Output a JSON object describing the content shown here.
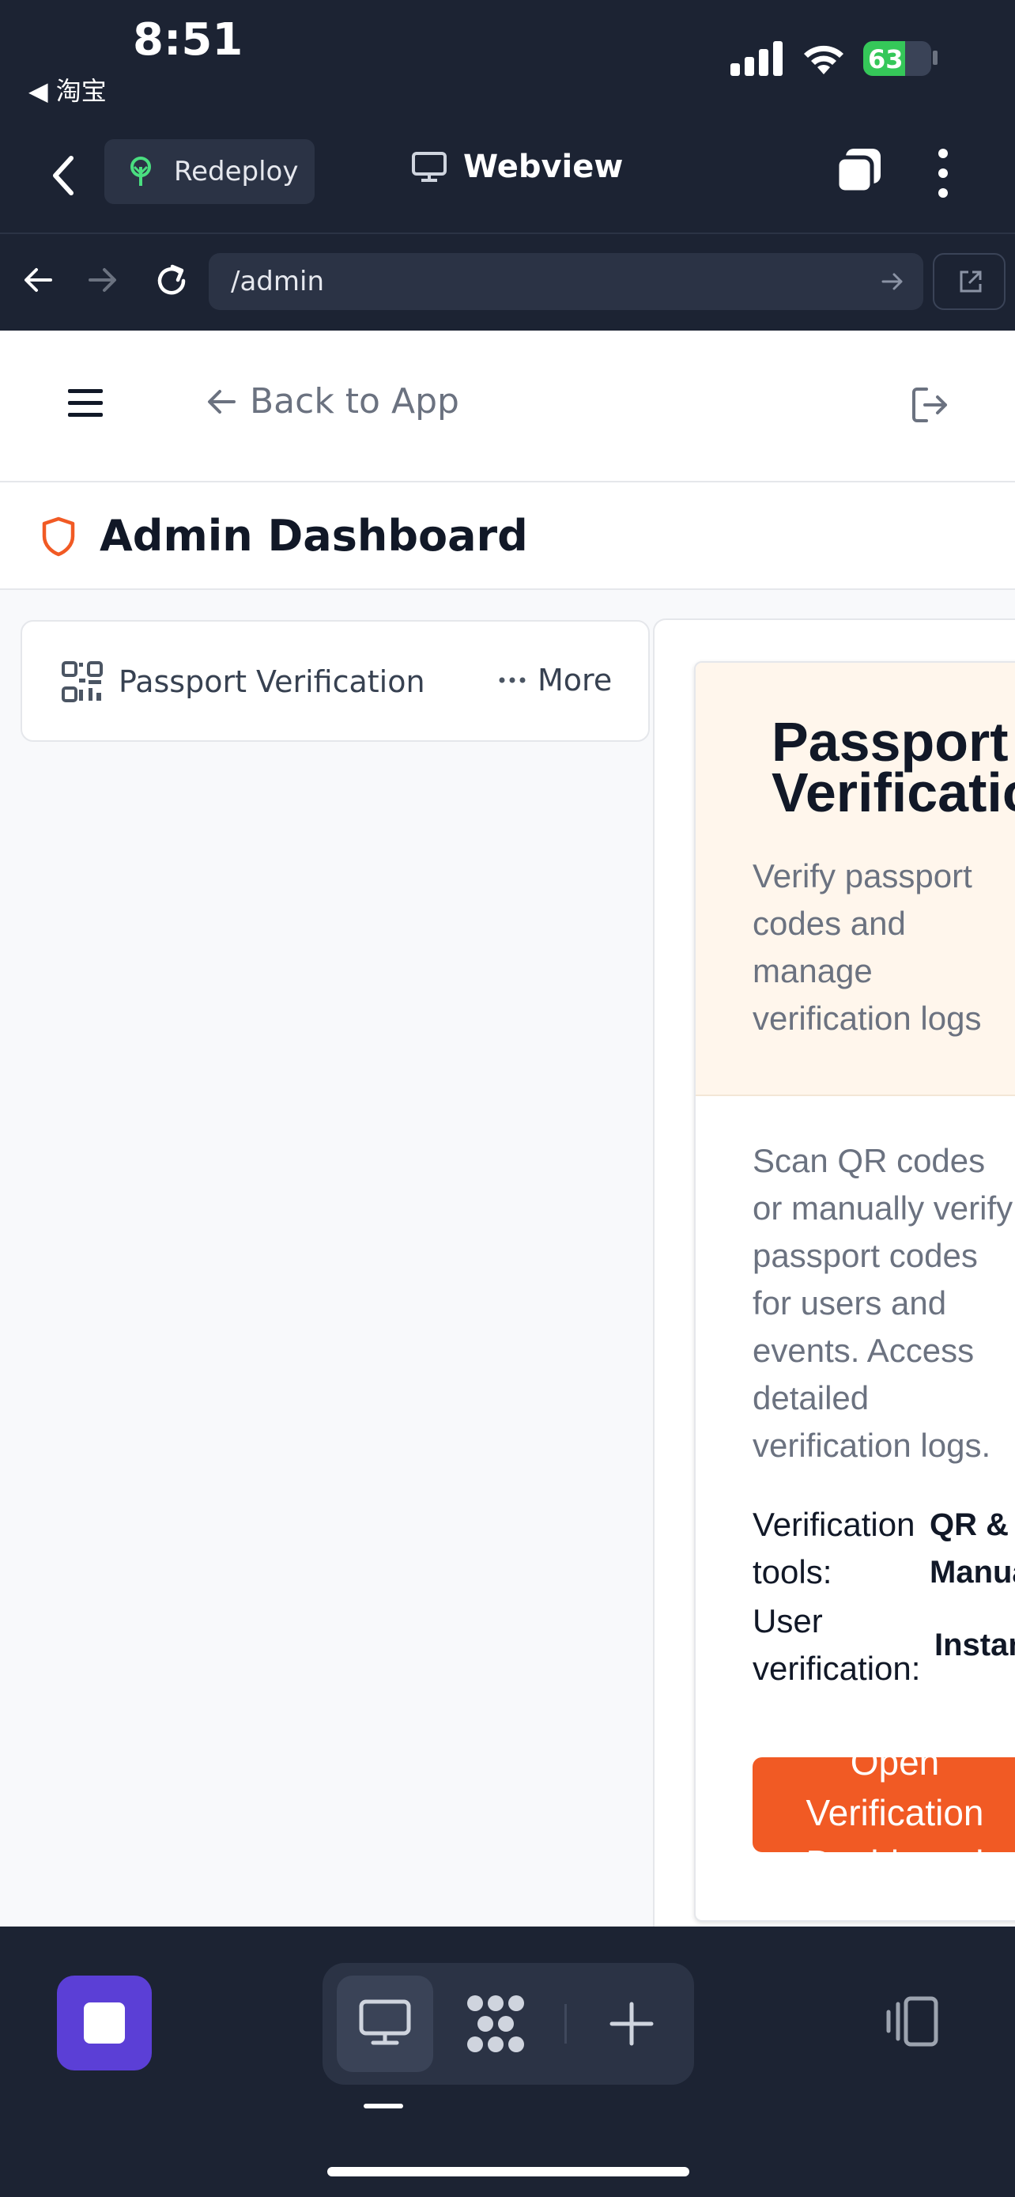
{
  "status_bar": {
    "time": "8:51",
    "back_app": "◀ 淘宝",
    "battery": "63"
  },
  "top_bar": {
    "redeploy_label": "Redeploy",
    "webview_label": "Webview"
  },
  "url_bar": {
    "url": "/admin"
  },
  "app_header": {
    "back_label": "Back to App",
    "page_title": "Admin Dashboard"
  },
  "nav": {
    "passport_label": "Passport Verification",
    "more_label": "More"
  },
  "card": {
    "title_line1": "Passport",
    "title_line2": "Verification",
    "subtitle": "Verify passport codes and manage verification logs",
    "description": "Scan QR codes or manually verify passport codes for users and events. Access detailed verification logs.",
    "rows": [
      {
        "label": "Verification tools:",
        "value": "QR & Manual"
      },
      {
        "label": "User verification:",
        "value": "Instant"
      }
    ],
    "button_lines": [
      "Open",
      "Verification",
      "Dashboard"
    ]
  },
  "colors": {
    "accent": "#f15a24",
    "chrome_bg": "#1c2333",
    "card_header_bg": "#fff6ec",
    "stop_button": "#5b3fd6"
  }
}
